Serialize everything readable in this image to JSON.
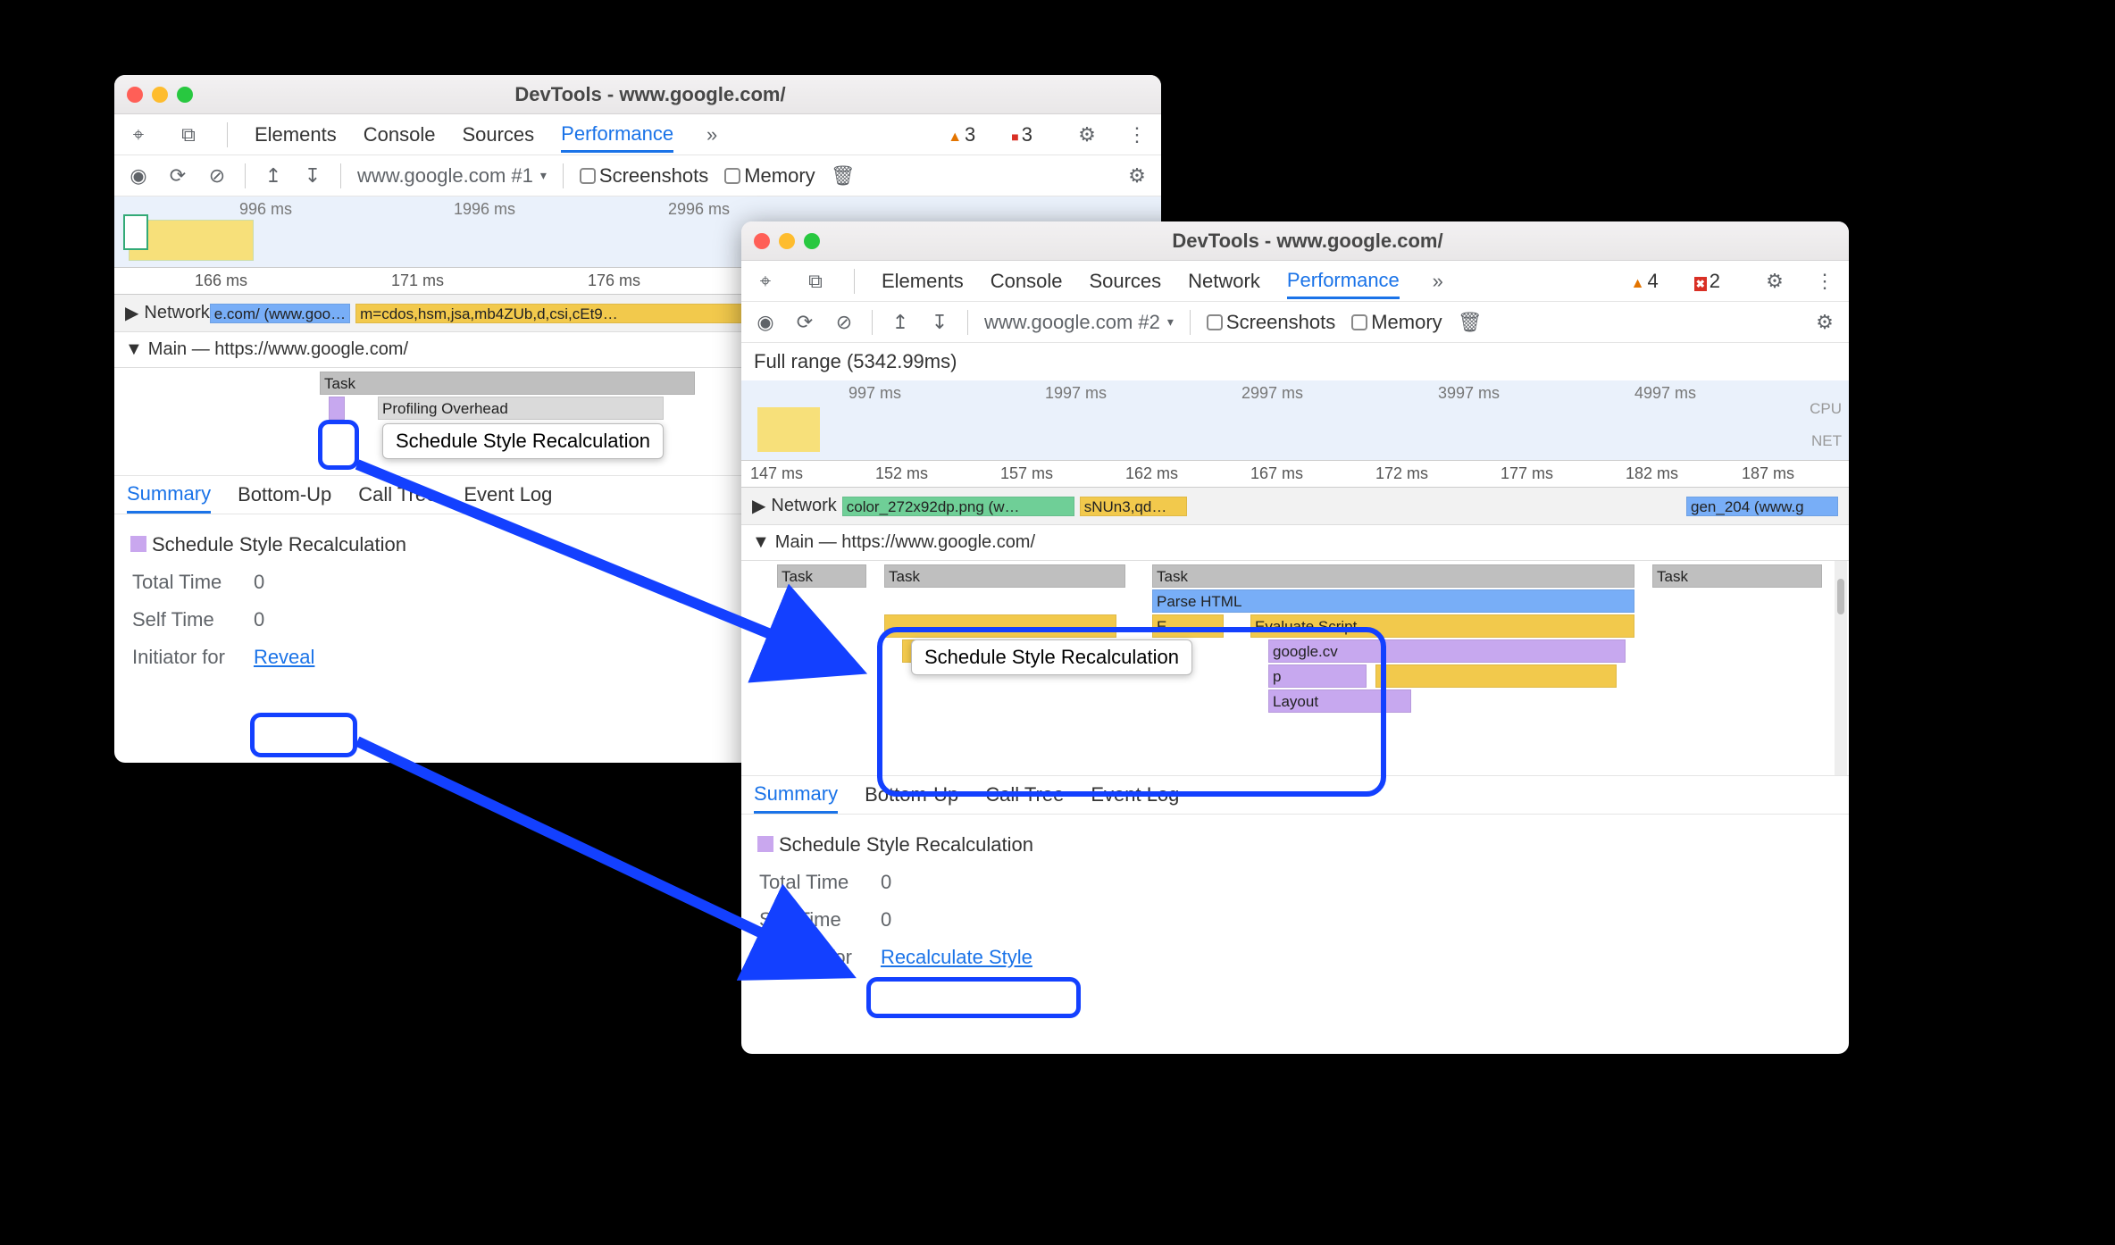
{
  "annotation_tooltip": "Schedule Style Recalculation",
  "win1": {
    "title": "DevTools - www.google.com/",
    "top_tabs": [
      "Elements",
      "Console",
      "Sources",
      "Performance"
    ],
    "top_active": 3,
    "warn_count": "3",
    "err_count": "3",
    "dropdown": "www.google.com #1",
    "chk_screenshots": "Screenshots",
    "chk_memory": "Memory",
    "overview_ticks": [
      "996 ms",
      "1996 ms",
      "2996 ms"
    ],
    "ruler_ticks": [
      "166 ms",
      "171 ms",
      "176 ms"
    ],
    "network_label": "Network",
    "network_bar1": "e.com/ (www.goo…",
    "network_bar2": "m=cdos,hsm,jsa,mb4ZUb,d,csi,cEt9…",
    "main_label": "Main — https://www.google.com/",
    "task": "Task",
    "profiling": "Profiling Overhead",
    "tooltip": "Schedule Style Recalculation",
    "panel_tabs": [
      "Summary",
      "Bottom-Up",
      "Call Tree",
      "Event Log"
    ],
    "summary_title": "Schedule Style Recalculation",
    "total_time_l": "Total Time",
    "total_time_v": "0",
    "self_time_l": "Self Time",
    "self_time_v": "0",
    "initiator_l": "Initiator for",
    "reveal": "Reveal"
  },
  "win2": {
    "title": "DevTools - www.google.com/",
    "top_tabs": [
      "Elements",
      "Console",
      "Sources",
      "Network",
      "Performance"
    ],
    "top_active": 4,
    "warn_count": "4",
    "err_count": "2",
    "dropdown": "www.google.com #2",
    "chk_screenshots": "Screenshots",
    "chk_memory": "Memory",
    "full_range": "Full range (5342.99ms)",
    "overview_ticks": [
      "997 ms",
      "1997 ms",
      "2997 ms",
      "3997 ms",
      "4997 ms"
    ],
    "side_cpu": "CPU",
    "side_net": "NET",
    "ruler_ticks": [
      "147 ms",
      "152 ms",
      "157 ms",
      "162 ms",
      "167 ms",
      "172 ms",
      "177 ms",
      "182 ms",
      "187 ms"
    ],
    "network_label": "Network",
    "net_bars": [
      "color_272x92dp.png (w…",
      "sNUn3,qd…",
      "gen_204 (www.g"
    ],
    "main_label": "Main — https://www.google.com/",
    "bars": {
      "task": "Task",
      "parse": "Parse HTML",
      "eval": "Evaluate Script",
      "e": "E…",
      "gcv": "google.cv",
      "p": "p",
      "layout": "Layout"
    },
    "panel_tabs": [
      "Summary",
      "Bottom-Up",
      "Call Tree",
      "Event Log"
    ],
    "summary_title": "Schedule Style Recalculation",
    "total_time_l": "Total Time",
    "total_time_v": "0",
    "self_time_l": "Self Time",
    "self_time_v": "0",
    "initiator_l": "Initiator for",
    "recalc": "Recalculate Style"
  }
}
